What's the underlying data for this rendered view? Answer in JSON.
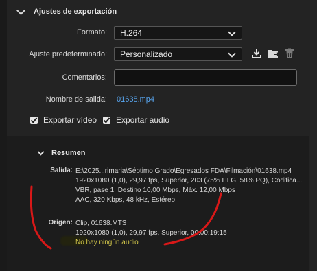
{
  "section": {
    "title": "Ajustes de exportación"
  },
  "form": {
    "format_label": "Formato:",
    "format_value": "H.264",
    "preset_label": "Ajuste predeterminado:",
    "preset_value": "Personalizado",
    "comments_label": "Comentarios:",
    "comments_value": "",
    "output_name_label": "Nombre de salida:",
    "output_name_value": "01638.mp4",
    "export_video_label": "Exportar vídeo",
    "export_audio_label": "Exportar audio",
    "export_video_checked": true,
    "export_audio_checked": true
  },
  "preset_actions": [
    {
      "icon": "save-preset-icon"
    },
    {
      "icon": "import-preset-icon"
    },
    {
      "icon": "trash-icon"
    }
  ],
  "summary": {
    "title": "Resumen",
    "output_label": "Salida:",
    "output_lines": [
      "E:\\2025...rimaria\\Séptimo Grado\\Egresados FDA\\Filmación\\01638.mp4",
      "1920x1080 (1,0), 29,97 fps, Superior, 203 (75% HLG, 58% PQ), Codifica...",
      "VBR, pase 1, Destino 10,00 Mbps, Máx. 12,00 Mbps",
      "AAC, 320 Kbps, 48 kHz, Estéreo"
    ],
    "source_label": "Origen:",
    "source_lines": [
      "Clip, 01638.MTS",
      "1920x1080 (1,0), 29,97 fps, Superior, 00:00:19:15"
    ],
    "source_warning": "No hay ningún audio"
  },
  "colors": {
    "link": "#58a6f0",
    "warning": "#d4c84a",
    "annotation": "#d81818"
  }
}
